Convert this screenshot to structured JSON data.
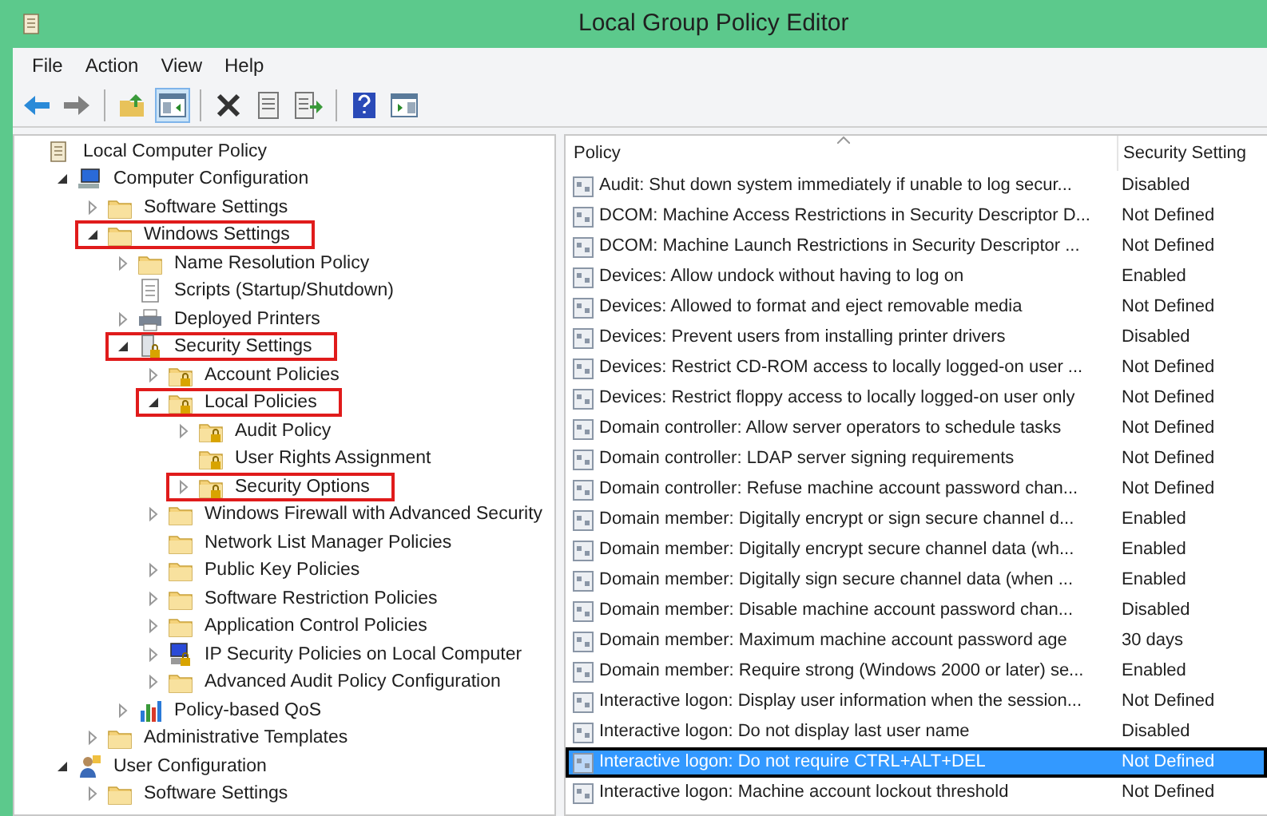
{
  "window": {
    "title": "Local Group Policy Editor"
  },
  "menu": [
    "File",
    "Action",
    "View",
    "Help"
  ],
  "toolbar": [
    {
      "kind": "back",
      "pressed": false
    },
    {
      "kind": "forward",
      "pressed": false
    },
    {
      "kind": "sep"
    },
    {
      "kind": "up",
      "pressed": false
    },
    {
      "kind": "tree",
      "pressed": true
    },
    {
      "kind": "sep"
    },
    {
      "kind": "delete",
      "pressed": false
    },
    {
      "kind": "properties",
      "pressed": false
    },
    {
      "kind": "export",
      "pressed": false
    },
    {
      "kind": "sep"
    },
    {
      "kind": "help",
      "pressed": false
    },
    {
      "kind": "pane",
      "pressed": false
    }
  ],
  "tree": [
    {
      "label": "Local Computer Policy",
      "kind": "policy",
      "highlighted": false,
      "children": [
        {
          "label": "Computer Configuration",
          "kind": "computer",
          "expanded": true,
          "highlighted": false,
          "children": [
            {
              "label": "Software Settings",
              "kind": "folder",
              "expanded": false,
              "highlighted": false
            },
            {
              "label": "Windows Settings",
              "kind": "folder",
              "expanded": true,
              "highlighted": true,
              "children": [
                {
                  "label": "Name Resolution Policy",
                  "kind": "folder",
                  "expanded": false,
                  "highlighted": false
                },
                {
                  "label": "Scripts (Startup/Shutdown)",
                  "kind": "script",
                  "highlighted": false
                },
                {
                  "label": "Deployed Printers",
                  "kind": "printer",
                  "expanded": false,
                  "highlighted": false
                },
                {
                  "label": "Security Settings",
                  "kind": "security",
                  "expanded": true,
                  "highlighted": true,
                  "children": [
                    {
                      "label": "Account Policies",
                      "kind": "lock-folder",
                      "expanded": false,
                      "highlighted": false
                    },
                    {
                      "label": "Local Policies",
                      "kind": "lock-folder",
                      "expanded": true,
                      "highlighted": true,
                      "children": [
                        {
                          "label": "Audit Policy",
                          "kind": "lock-folder",
                          "expanded": false,
                          "highlighted": false
                        },
                        {
                          "label": "User Rights Assignment",
                          "kind": "lock-folder",
                          "highlighted": false
                        },
                        {
                          "label": "Security Options",
                          "kind": "lock-folder",
                          "expanded": false,
                          "highlighted": true
                        }
                      ]
                    },
                    {
                      "label": "Windows Firewall with Advanced Security",
                      "kind": "folder",
                      "expanded": false,
                      "highlighted": false
                    },
                    {
                      "label": "Network List Manager Policies",
                      "kind": "folder",
                      "highlighted": false
                    },
                    {
                      "label": "Public Key Policies",
                      "kind": "folder",
                      "expanded": false,
                      "highlighted": false
                    },
                    {
                      "label": "Software Restriction Policies",
                      "kind": "folder",
                      "expanded": false,
                      "highlighted": false
                    },
                    {
                      "label": "Application Control Policies",
                      "kind": "folder",
                      "expanded": false,
                      "highlighted": false
                    },
                    {
                      "label": "IP Security Policies on Local Computer",
                      "kind": "ip-security",
                      "expanded": false,
                      "highlighted": false
                    },
                    {
                      "label": "Advanced Audit Policy Configuration",
                      "kind": "folder",
                      "expanded": false,
                      "highlighted": false
                    }
                  ]
                },
                {
                  "label": "Policy-based QoS",
                  "kind": "chart",
                  "expanded": false,
                  "highlighted": false
                }
              ]
            },
            {
              "label": "Administrative Templates",
              "kind": "folder",
              "expanded": false,
              "highlighted": false
            }
          ]
        },
        {
          "label": "User Configuration",
          "kind": "user",
          "expanded": true,
          "highlighted": false,
          "children": [
            {
              "label": "Software Settings",
              "kind": "folder",
              "expanded": false,
              "highlighted": false
            }
          ]
        }
      ]
    }
  ],
  "table": {
    "columns": [
      "Policy",
      "Security Setting"
    ],
    "rows": [
      {
        "policy": "Audit: Shut down system immediately if unable to log secur...",
        "setting": "Disabled",
        "selected": false
      },
      {
        "policy": "DCOM: Machine Access Restrictions in Security Descriptor D...",
        "setting": "Not Defined",
        "selected": false
      },
      {
        "policy": "DCOM: Machine Launch Restrictions in Security Descriptor ...",
        "setting": "Not Defined",
        "selected": false
      },
      {
        "policy": "Devices: Allow undock without having to log on",
        "setting": "Enabled",
        "selected": false
      },
      {
        "policy": "Devices: Allowed to format and eject removable media",
        "setting": "Not Defined",
        "selected": false
      },
      {
        "policy": "Devices: Prevent users from installing printer drivers",
        "setting": "Disabled",
        "selected": false
      },
      {
        "policy": "Devices: Restrict CD-ROM access to locally logged-on user ...",
        "setting": "Not Defined",
        "selected": false
      },
      {
        "policy": "Devices: Restrict floppy access to locally logged-on user only",
        "setting": "Not Defined",
        "selected": false
      },
      {
        "policy": "Domain controller: Allow server operators to schedule tasks",
        "setting": "Not Defined",
        "selected": false
      },
      {
        "policy": "Domain controller: LDAP server signing requirements",
        "setting": "Not Defined",
        "selected": false
      },
      {
        "policy": "Domain controller: Refuse machine account password chan...",
        "setting": "Not Defined",
        "selected": false
      },
      {
        "policy": "Domain member: Digitally encrypt or sign secure channel d...",
        "setting": "Enabled",
        "selected": false
      },
      {
        "policy": "Domain member: Digitally encrypt secure channel data (wh...",
        "setting": "Enabled",
        "selected": false
      },
      {
        "policy": "Domain member: Digitally sign secure channel data (when ...",
        "setting": "Enabled",
        "selected": false
      },
      {
        "policy": "Domain member: Disable machine account password chan...",
        "setting": "Disabled",
        "selected": false
      },
      {
        "policy": "Domain member: Maximum machine account password age",
        "setting": "30 days",
        "selected": false
      },
      {
        "policy": "Domain member: Require strong (Windows 2000 or later) se...",
        "setting": "Enabled",
        "selected": false
      },
      {
        "policy": "Interactive logon: Display user information when the session...",
        "setting": "Not Defined",
        "selected": false
      },
      {
        "policy": "Interactive logon: Do not display last user name",
        "setting": "Disabled",
        "selected": false
      },
      {
        "policy": "Interactive logon: Do not require CTRL+ALT+DEL",
        "setting": "Not Defined",
        "selected": true
      },
      {
        "policy": "Interactive logon: Machine account lockout threshold",
        "setting": "Not Defined",
        "selected": false
      }
    ]
  }
}
